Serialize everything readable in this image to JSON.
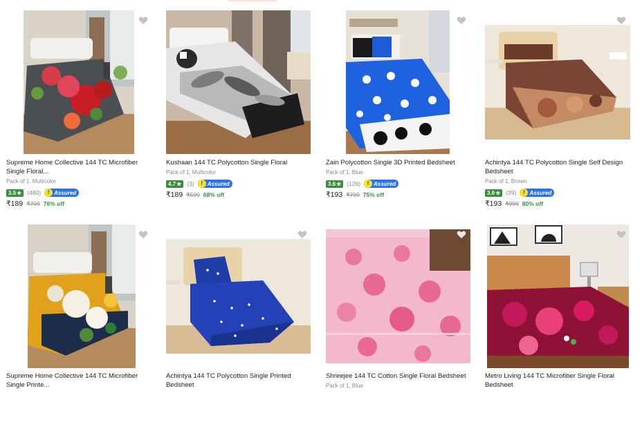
{
  "products": [
    {
      "title": "Supreme Home Collective 144 TC Microfiber Single Floral...",
      "meta": "Pack of 1, Multicolor",
      "rating": "3.5",
      "reviews": "(480)",
      "price": "₹189",
      "mrp": "₹799",
      "off": "76% off",
      "assured": "Assured",
      "theme": "floral-red"
    },
    {
      "title": "Kushaan 144 TC Polycotton Single Floral Bedsheet",
      "meta": "Pack of 1, Multicolor",
      "rating": "4.7",
      "reviews": "(3)",
      "price": "₹189",
      "mrp": "₹599",
      "off": "68% off",
      "assured": "Assured",
      "theme": "leaf-grey"
    },
    {
      "title": "Zain Polycotton Single 3D Printed Bedsheet",
      "meta": "Pack of 1, Blue",
      "rating": "3.6",
      "reviews": "(126)",
      "price": "₹193",
      "mrp": "₹799",
      "off": "75% off",
      "assured": "Assured",
      "theme": "blue-floral"
    },
    {
      "title": "Achintya 144 TC Polycotton Single Self Design Bedsheet",
      "meta": "Pack of 1, Brown",
      "rating": "3.6",
      "reviews": "(39)",
      "price": "₹193",
      "mrp": "₹999",
      "off": "80% off",
      "assured": "Assured",
      "theme": "brown-paisley"
    },
    {
      "title": "Supreme Home Collective 144 TC Microfiber Single Printe...",
      "meta": "",
      "theme": "yellow-floral"
    },
    {
      "title": "Achintya 144 TC Polycotton Single Printed Bedsheet",
      "meta": "",
      "theme": "blue-stars"
    },
    {
      "title": "Shreejee 144 TC Cotton Single Floral Bedsheet",
      "meta": "Pack of 1, Blue",
      "theme": "pink-floral"
    },
    {
      "title": "Metro Living 144 TC Microfiber Single Floral Bedsheet",
      "meta": "",
      "theme": "maroon-floral"
    }
  ],
  "rating_star": "★",
  "wishlist_icon": "heart-icon",
  "colors": {
    "rating_green": "#388e3c",
    "assured_blue": "#2874f0",
    "assured_yellow": "#ffe11b",
    "discount_green": "#388e3c"
  }
}
